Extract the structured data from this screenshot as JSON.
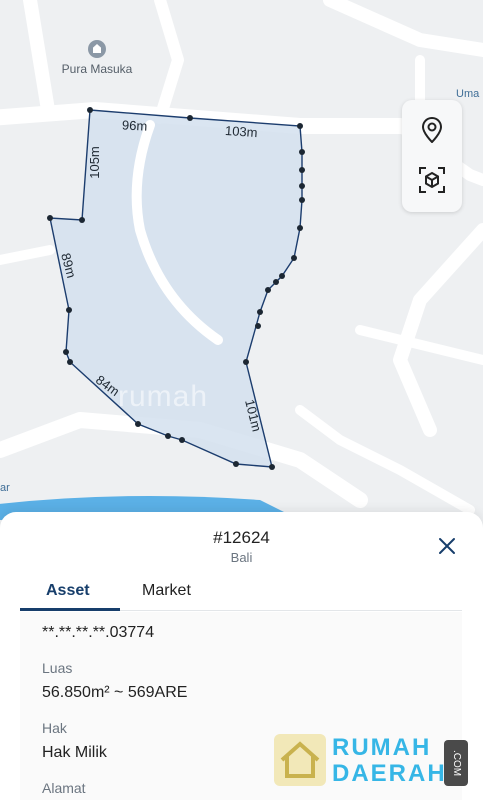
{
  "map": {
    "poi_label": "Pura Masuka",
    "corner_top_right": "Uma",
    "corner_left": "ar",
    "edges": {
      "top_left": "96m",
      "top_right": "103m",
      "west_upper": "105m",
      "west_lower": "89m",
      "south_west": "84m",
      "east": "101m"
    },
    "watermark": "rumah",
    "colors": {
      "parcel_fill": "#d4e0ef",
      "parcel_line": "#1c3d6e",
      "water": "#5bb0e6"
    }
  },
  "toolbar": {
    "pin_icon": "location-pin-icon",
    "cube_icon": "3d-view-icon"
  },
  "sheet": {
    "title": "#12624",
    "subtitle": "Bali",
    "close_icon": "close-icon",
    "tabs": [
      {
        "label": "Asset",
        "active": true
      },
      {
        "label": "Market",
        "active": false
      }
    ],
    "fields": {
      "nib_value": "**.**.**.**.03774",
      "luas_label": "Luas",
      "luas_value": "56.850m² ~ 569ARE",
      "hak_label": "Hak",
      "hak_value": "Hak Milik",
      "alamat_label": "Alamat"
    }
  },
  "brand": {
    "line1": "RUMAH",
    "line2": "DAERAH",
    "suffix": ".COM"
  }
}
